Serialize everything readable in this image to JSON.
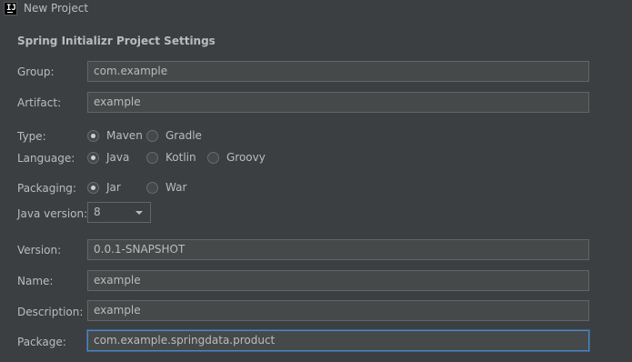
{
  "window": {
    "title": "New Project",
    "icon": "intellij-idea-icon"
  },
  "section_title": "Spring Initializr Project Settings",
  "fields": {
    "group": {
      "label": "Group:",
      "value": "com.example"
    },
    "artifact": {
      "label": "Artifact:",
      "value": "example"
    },
    "version": {
      "label": "Version:",
      "value": "0.0.1-SNAPSHOT"
    },
    "name": {
      "label": "Name:",
      "value": "example"
    },
    "description": {
      "label": "Description:",
      "value": "example"
    },
    "package": {
      "label": "Package:",
      "value": "com.example.springdata.product"
    }
  },
  "type": {
    "label": "Type:",
    "options": [
      "Maven",
      "Gradle"
    ],
    "selected": "Maven"
  },
  "language": {
    "label": "Language:",
    "options": [
      "Java",
      "Kotlin",
      "Groovy"
    ],
    "selected": "Java"
  },
  "packaging": {
    "label": "Packaging:",
    "options": [
      "Jar",
      "War"
    ],
    "selected": "Jar"
  },
  "java_version": {
    "label": "Java version:",
    "value": "8"
  },
  "colors": {
    "background": "#3c3f41",
    "field_bg": "#45494a",
    "focus_border": "#4a88c7"
  }
}
